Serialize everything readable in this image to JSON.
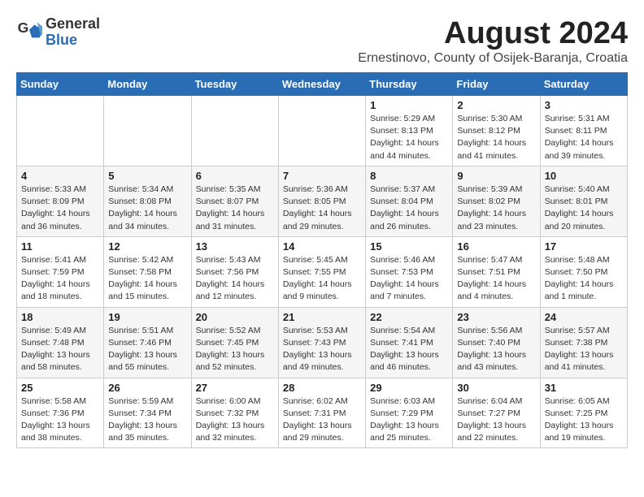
{
  "header": {
    "logo_general": "General",
    "logo_blue": "Blue",
    "month_title": "August 2024",
    "location": "Ernestinovo, County of Osijek-Baranja, Croatia"
  },
  "weekdays": [
    "Sunday",
    "Monday",
    "Tuesday",
    "Wednesday",
    "Thursday",
    "Friday",
    "Saturday"
  ],
  "weeks": [
    [
      {
        "day": "",
        "info": ""
      },
      {
        "day": "",
        "info": ""
      },
      {
        "day": "",
        "info": ""
      },
      {
        "day": "",
        "info": ""
      },
      {
        "day": "1",
        "info": "Sunrise: 5:29 AM\nSunset: 8:13 PM\nDaylight: 14 hours\nand 44 minutes."
      },
      {
        "day": "2",
        "info": "Sunrise: 5:30 AM\nSunset: 8:12 PM\nDaylight: 14 hours\nand 41 minutes."
      },
      {
        "day": "3",
        "info": "Sunrise: 5:31 AM\nSunset: 8:11 PM\nDaylight: 14 hours\nand 39 minutes."
      }
    ],
    [
      {
        "day": "4",
        "info": "Sunrise: 5:33 AM\nSunset: 8:09 PM\nDaylight: 14 hours\nand 36 minutes."
      },
      {
        "day": "5",
        "info": "Sunrise: 5:34 AM\nSunset: 8:08 PM\nDaylight: 14 hours\nand 34 minutes."
      },
      {
        "day": "6",
        "info": "Sunrise: 5:35 AM\nSunset: 8:07 PM\nDaylight: 14 hours\nand 31 minutes."
      },
      {
        "day": "7",
        "info": "Sunrise: 5:36 AM\nSunset: 8:05 PM\nDaylight: 14 hours\nand 29 minutes."
      },
      {
        "day": "8",
        "info": "Sunrise: 5:37 AM\nSunset: 8:04 PM\nDaylight: 14 hours\nand 26 minutes."
      },
      {
        "day": "9",
        "info": "Sunrise: 5:39 AM\nSunset: 8:02 PM\nDaylight: 14 hours\nand 23 minutes."
      },
      {
        "day": "10",
        "info": "Sunrise: 5:40 AM\nSunset: 8:01 PM\nDaylight: 14 hours\nand 20 minutes."
      }
    ],
    [
      {
        "day": "11",
        "info": "Sunrise: 5:41 AM\nSunset: 7:59 PM\nDaylight: 14 hours\nand 18 minutes."
      },
      {
        "day": "12",
        "info": "Sunrise: 5:42 AM\nSunset: 7:58 PM\nDaylight: 14 hours\nand 15 minutes."
      },
      {
        "day": "13",
        "info": "Sunrise: 5:43 AM\nSunset: 7:56 PM\nDaylight: 14 hours\nand 12 minutes."
      },
      {
        "day": "14",
        "info": "Sunrise: 5:45 AM\nSunset: 7:55 PM\nDaylight: 14 hours\nand 9 minutes."
      },
      {
        "day": "15",
        "info": "Sunrise: 5:46 AM\nSunset: 7:53 PM\nDaylight: 14 hours\nand 7 minutes."
      },
      {
        "day": "16",
        "info": "Sunrise: 5:47 AM\nSunset: 7:51 PM\nDaylight: 14 hours\nand 4 minutes."
      },
      {
        "day": "17",
        "info": "Sunrise: 5:48 AM\nSunset: 7:50 PM\nDaylight: 14 hours\nand 1 minute."
      }
    ],
    [
      {
        "day": "18",
        "info": "Sunrise: 5:49 AM\nSunset: 7:48 PM\nDaylight: 13 hours\nand 58 minutes."
      },
      {
        "day": "19",
        "info": "Sunrise: 5:51 AM\nSunset: 7:46 PM\nDaylight: 13 hours\nand 55 minutes."
      },
      {
        "day": "20",
        "info": "Sunrise: 5:52 AM\nSunset: 7:45 PM\nDaylight: 13 hours\nand 52 minutes."
      },
      {
        "day": "21",
        "info": "Sunrise: 5:53 AM\nSunset: 7:43 PM\nDaylight: 13 hours\nand 49 minutes."
      },
      {
        "day": "22",
        "info": "Sunrise: 5:54 AM\nSunset: 7:41 PM\nDaylight: 13 hours\nand 46 minutes."
      },
      {
        "day": "23",
        "info": "Sunrise: 5:56 AM\nSunset: 7:40 PM\nDaylight: 13 hours\nand 43 minutes."
      },
      {
        "day": "24",
        "info": "Sunrise: 5:57 AM\nSunset: 7:38 PM\nDaylight: 13 hours\nand 41 minutes."
      }
    ],
    [
      {
        "day": "25",
        "info": "Sunrise: 5:58 AM\nSunset: 7:36 PM\nDaylight: 13 hours\nand 38 minutes."
      },
      {
        "day": "26",
        "info": "Sunrise: 5:59 AM\nSunset: 7:34 PM\nDaylight: 13 hours\nand 35 minutes."
      },
      {
        "day": "27",
        "info": "Sunrise: 6:00 AM\nSunset: 7:32 PM\nDaylight: 13 hours\nand 32 minutes."
      },
      {
        "day": "28",
        "info": "Sunrise: 6:02 AM\nSunset: 7:31 PM\nDaylight: 13 hours\nand 29 minutes."
      },
      {
        "day": "29",
        "info": "Sunrise: 6:03 AM\nSunset: 7:29 PM\nDaylight: 13 hours\nand 25 minutes."
      },
      {
        "day": "30",
        "info": "Sunrise: 6:04 AM\nSunset: 7:27 PM\nDaylight: 13 hours\nand 22 minutes."
      },
      {
        "day": "31",
        "info": "Sunrise: 6:05 AM\nSunset: 7:25 PM\nDaylight: 13 hours\nand 19 minutes."
      }
    ]
  ]
}
